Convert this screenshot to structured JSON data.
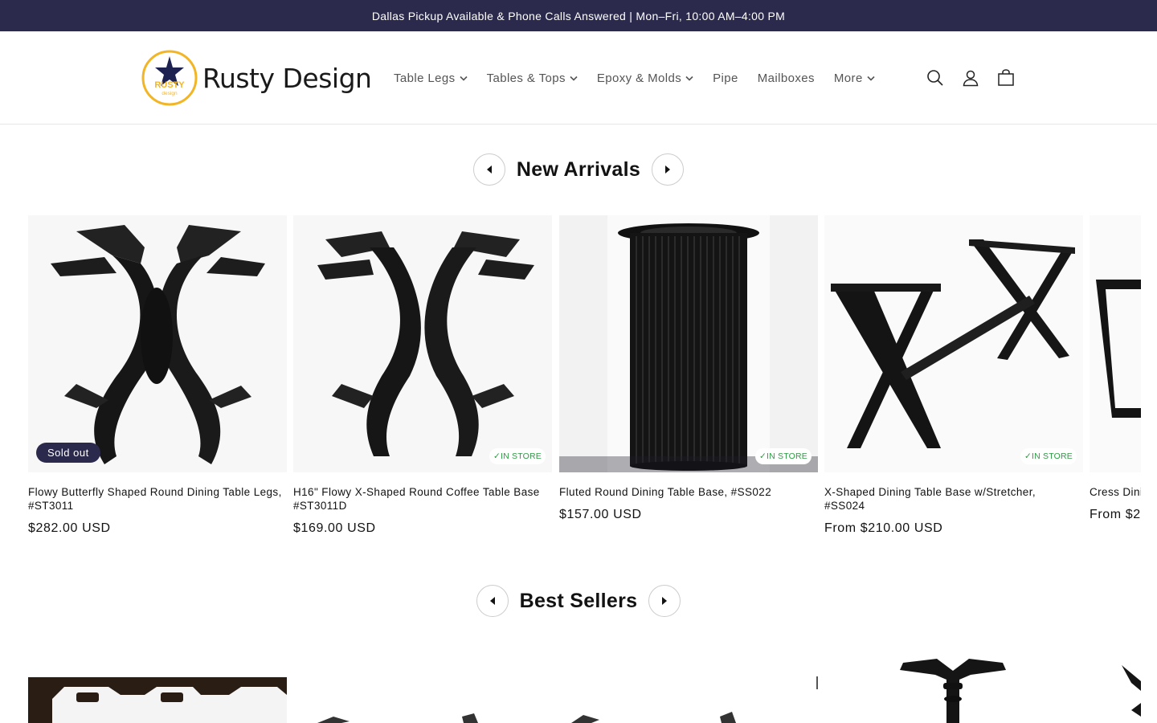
{
  "announcement": "Dallas Pickup Available & Phone Calls Answered | Mon–Fri, 10:00 AM–4:00 PM",
  "brand": {
    "logo_badge": "RUSTY",
    "logo_sub": "design",
    "name": "Rusty Design"
  },
  "nav": [
    {
      "label": "Table Legs",
      "has_dropdown": true
    },
    {
      "label": "Tables & Tops",
      "has_dropdown": true
    },
    {
      "label": "Epoxy & Molds",
      "has_dropdown": true
    },
    {
      "label": "Pipe",
      "has_dropdown": false
    },
    {
      "label": "Mailboxes",
      "has_dropdown": false
    },
    {
      "label": "More",
      "has_dropdown": true
    }
  ],
  "header_icons": [
    "search-icon",
    "account-icon",
    "cart-icon"
  ],
  "new_arrivals": {
    "title": "New Arrivals",
    "products": [
      {
        "title": "Flowy Butterfly Shaped Round Dining Table Legs, #ST3011",
        "price": "$282.00 USD",
        "badge": "Sold out"
      },
      {
        "title": "H16\" Flowy X-Shaped Round Coffee Table Base #ST3011D",
        "price": "$169.00 USD",
        "badge": "✓IN STORE"
      },
      {
        "title": "Fluted Round Dining Table Base, #SS022",
        "price": "$157.00 USD",
        "badge": "✓IN STORE"
      },
      {
        "title": "X-Shaped Dining Table Base w/Stretcher, #SS024",
        "price": "From $210.00 USD",
        "badge": "✓IN STORE"
      },
      {
        "title": "Cress Dini",
        "price": "From $2"
      }
    ]
  },
  "best_sellers": {
    "title": "Best Sellers"
  },
  "colors": {
    "announcement_bg": "#2b2a4c",
    "sold_out_bg": "#2b2a4c",
    "in_store_text": "#2e9a44",
    "logo_ring": "#f2b526"
  }
}
